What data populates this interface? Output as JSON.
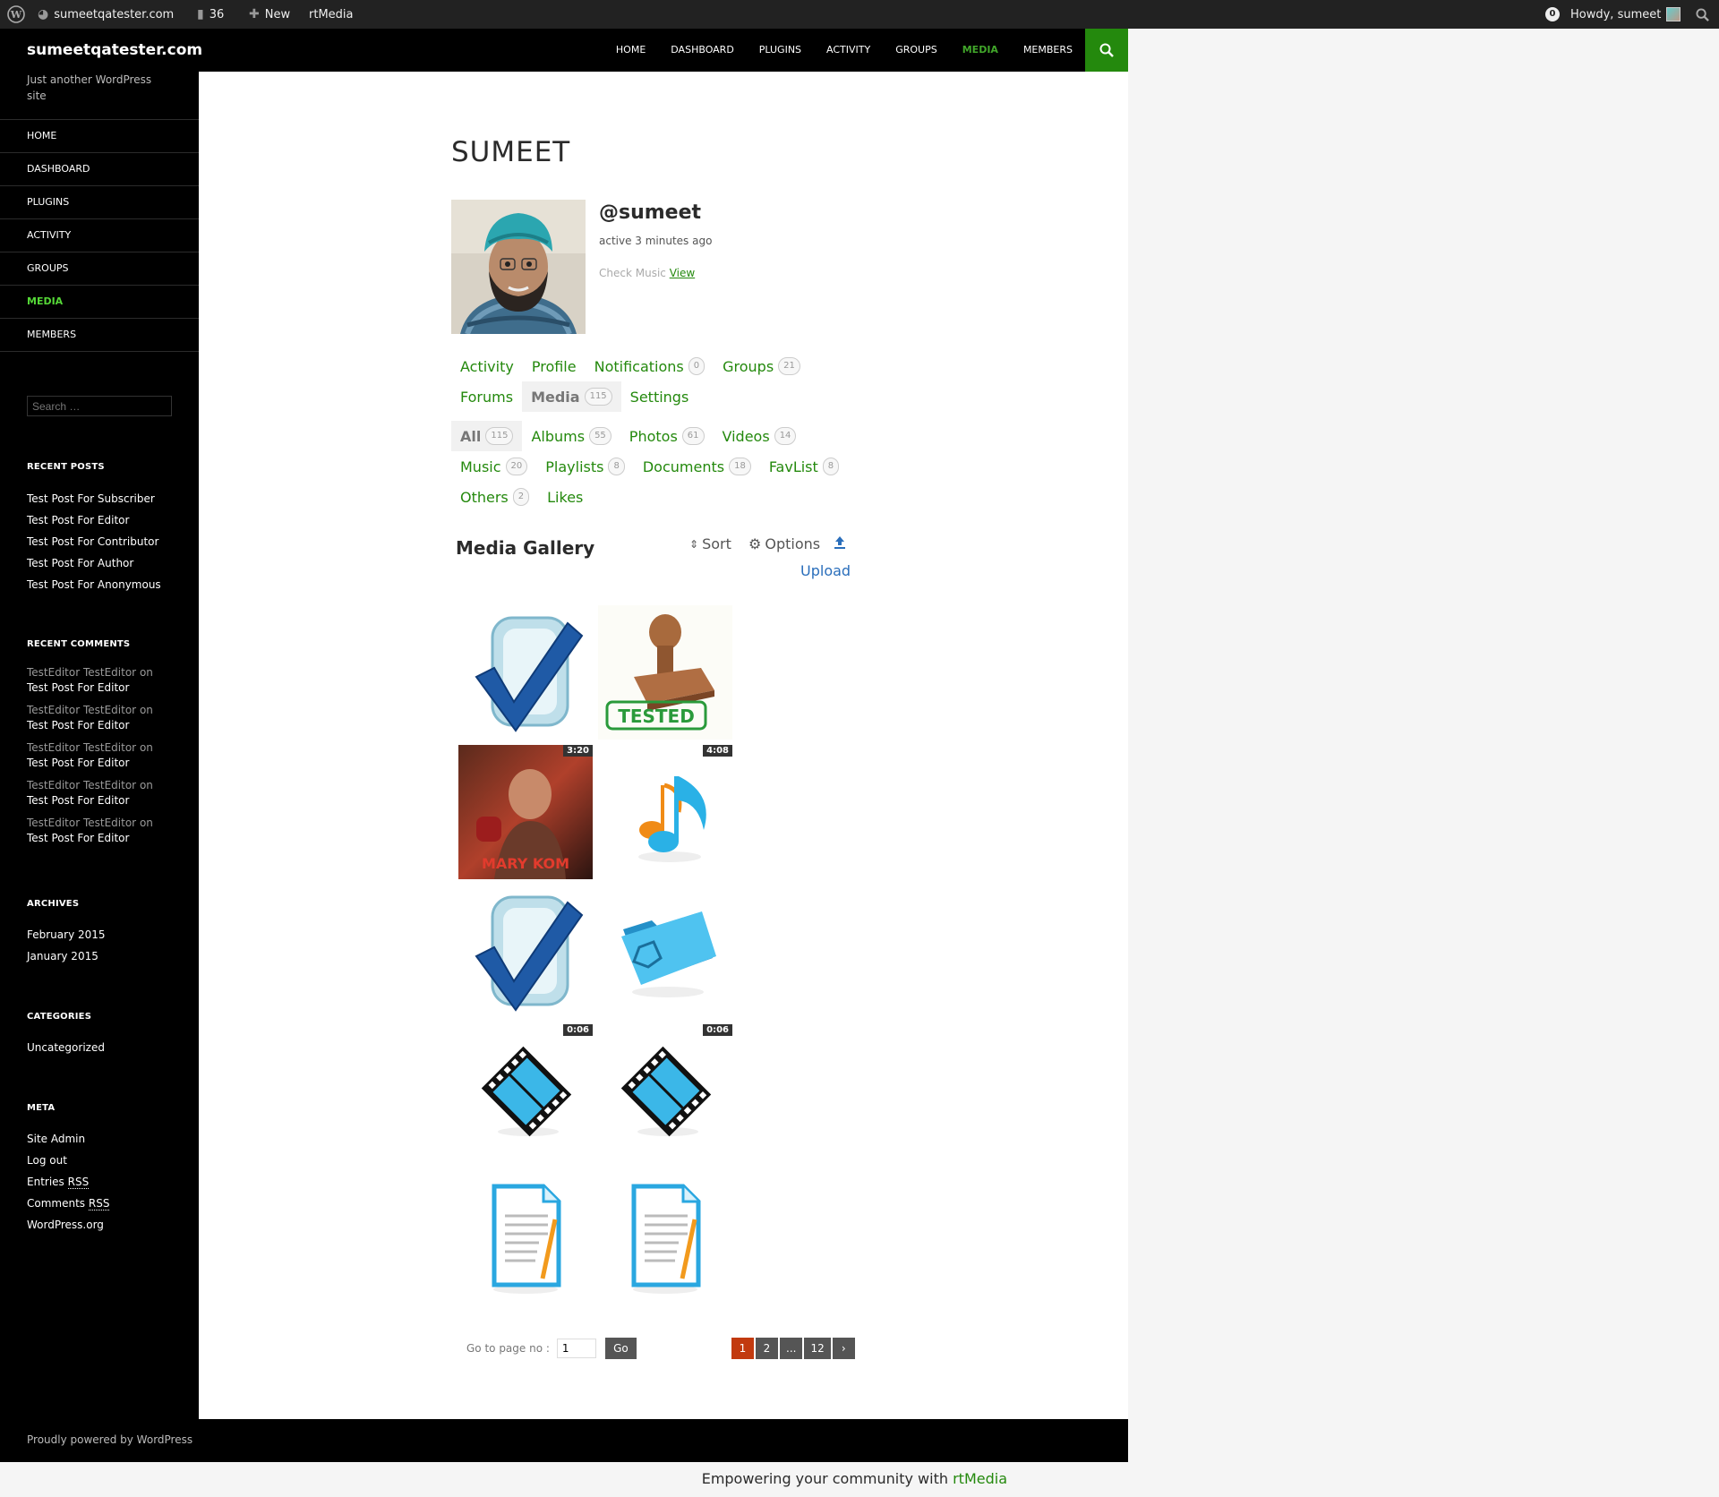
{
  "admin_bar": {
    "site": "sumeetqatester.com",
    "comments_count": "36",
    "new_label": "New",
    "plugin_label": "rtMedia",
    "notifications": "0",
    "howdy": "Howdy, sumeet"
  },
  "header": {
    "site_title": "sumeetqatester.com",
    "nav": [
      "HOME",
      "DASHBOARD",
      "PLUGINS",
      "ACTIVITY",
      "GROUPS",
      "MEDIA",
      "MEMBERS"
    ],
    "active_nav": "MEDIA"
  },
  "sidebar": {
    "tagline": "Just another WordPress site",
    "nav": [
      "HOME",
      "DASHBOARD",
      "PLUGINS",
      "ACTIVITY",
      "GROUPS",
      "MEDIA",
      "MEMBERS"
    ],
    "search_placeholder": "Search …",
    "recent_posts_title": "RECENT POSTS",
    "recent_posts": [
      "Test Post For Subscriber",
      "Test Post For Editor",
      "Test Post For Contributor",
      "Test Post For Author",
      "Test Post For Anonymous"
    ],
    "recent_comments_title": "RECENT COMMENTS",
    "recent_comments": [
      {
        "author": "TestEditor TestEditor",
        "on": "on",
        "post": "Test Post For Editor"
      },
      {
        "author": "TestEditor TestEditor",
        "on": "on",
        "post": "Test Post For Editor"
      },
      {
        "author": "TestEditor TestEditor",
        "on": "on",
        "post": "Test Post For Editor"
      },
      {
        "author": "TestEditor TestEditor",
        "on": "on",
        "post": "Test Post For Editor"
      },
      {
        "author": "TestEditor TestEditor",
        "on": "on",
        "post": "Test Post For Editor"
      }
    ],
    "archives_title": "ARCHIVES",
    "archives": [
      "February 2015",
      "January 2015"
    ],
    "categories_title": "CATEGORIES",
    "categories": [
      "Uncategorized"
    ],
    "meta_title": "META",
    "meta": {
      "site_admin": "Site Admin",
      "log_out": "Log out",
      "entries": "Entries",
      "comments": "Comments",
      "rss": "RSS",
      "wordpress_org": "WordPress.org"
    }
  },
  "profile": {
    "page_title": "SUMEET",
    "username": "@sumeet",
    "last_active": "active 3 minutes ago",
    "check_music": "Check Music",
    "view_link": "View"
  },
  "profile_tabs": [
    {
      "label": "Activity",
      "count": null
    },
    {
      "label": "Profile",
      "count": null
    },
    {
      "label": "Notifications",
      "count": "0"
    },
    {
      "label": "Groups",
      "count": "21"
    },
    {
      "label": "Forums",
      "count": null
    },
    {
      "label": "Media",
      "count": "115"
    },
    {
      "label": "Settings",
      "count": null
    }
  ],
  "media_tabs": [
    {
      "label": "All",
      "count": "115"
    },
    {
      "label": "Albums",
      "count": "55"
    },
    {
      "label": "Photos",
      "count": "61"
    },
    {
      "label": "Videos",
      "count": "14"
    },
    {
      "label": "Music",
      "count": "20"
    },
    {
      "label": "Playlists",
      "count": "8"
    },
    {
      "label": "Documents",
      "count": "18"
    },
    {
      "label": "FavList",
      "count": "8"
    },
    {
      "label": "Others",
      "count": "2"
    },
    {
      "label": "Likes",
      "count": null
    }
  ],
  "gallery": {
    "title": "Media Gallery",
    "sort_label": "Sort",
    "options_label": "Options",
    "upload_label": "Upload",
    "items": [
      {
        "type": "checkmark",
        "duration": null
      },
      {
        "type": "tested-stamp",
        "duration": null
      },
      {
        "type": "movie-poster",
        "duration": "3:20"
      },
      {
        "type": "music-note",
        "duration": "4:08"
      },
      {
        "type": "checkmark",
        "duration": null
      },
      {
        "type": "folder",
        "duration": null
      },
      {
        "type": "film",
        "duration": "0:06"
      },
      {
        "type": "film",
        "duration": "0:06"
      },
      {
        "type": "document",
        "duration": null
      },
      {
        "type": "document",
        "duration": null
      }
    ],
    "stamp_text": "TESTED",
    "poster_text": "MARY KOM"
  },
  "pager": {
    "go_to_label": "Go to page no :",
    "page_value": "1",
    "go_label": "Go",
    "pages": [
      "1",
      "2",
      "...",
      "12",
      "›"
    ],
    "current": "1"
  },
  "footer": {
    "powered": "Proudly powered by WordPress",
    "empowering": "Empowering your community with",
    "rtmedia": "rtMedia"
  },
  "colors": {
    "accent": "#24890d",
    "active_nav": "#41a62a",
    "pager_current": "#c23a0f"
  }
}
